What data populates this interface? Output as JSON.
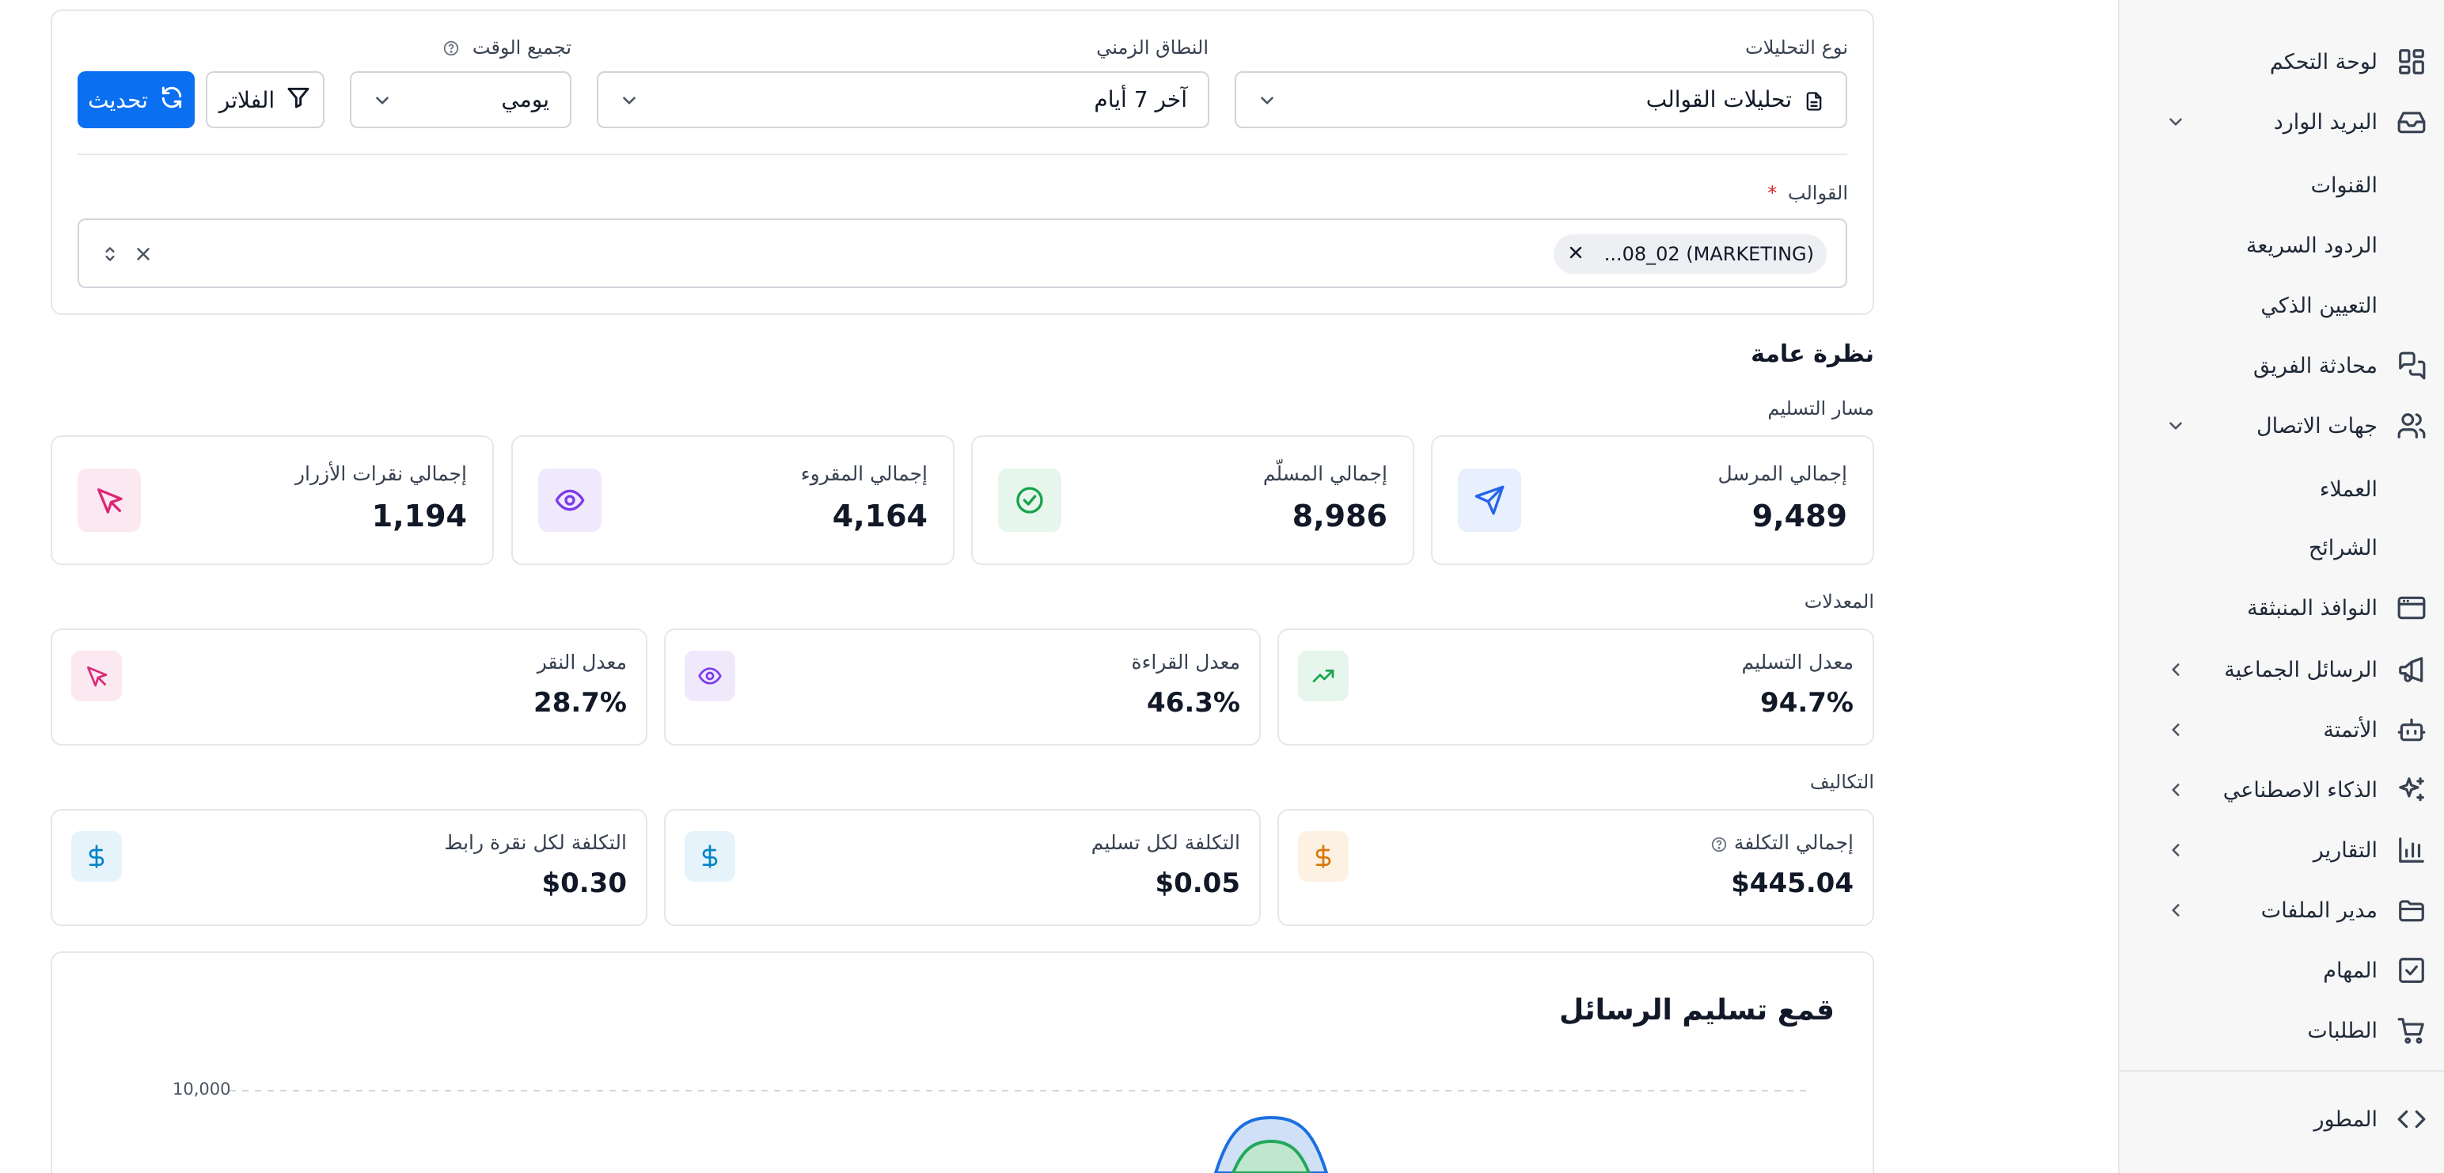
{
  "sidebar": {
    "items": [
      {
        "label": "لوحة التحكم",
        "icon": "dashboard-icon",
        "chevron": "none"
      },
      {
        "label": "البريد الوارد",
        "icon": "inbox-icon",
        "chevron": "down"
      },
      {
        "label": "القنوات",
        "icon": "",
        "chevron": "none"
      },
      {
        "label": "الردود السريعة",
        "icon": "",
        "chevron": "none"
      },
      {
        "label": "التعيين الذكي",
        "icon": "",
        "chevron": "none"
      },
      {
        "label": "محادثة الفريق",
        "icon": "chat-bubbles-icon",
        "chevron": "none"
      },
      {
        "label": "جهات الاتصال",
        "icon": "users-icon",
        "chevron": "down"
      },
      {
        "label": "العملاء",
        "icon": "",
        "chevron": "none"
      },
      {
        "label": "الشرائح",
        "icon": "",
        "chevron": "none"
      },
      {
        "label": "النوافذ المنبثقة",
        "icon": "window-icon",
        "chevron": "none"
      },
      {
        "label": "الرسائل الجماعية",
        "icon": "megaphone-icon",
        "chevron": "left"
      },
      {
        "label": "الأتمتة",
        "icon": "bot-icon",
        "chevron": "left"
      },
      {
        "label": "الذكاء الاصطناعي",
        "icon": "sparkles-icon",
        "chevron": "left"
      },
      {
        "label": "التقارير",
        "icon": "bar-chart-icon",
        "chevron": "left"
      },
      {
        "label": "مدير الملفات",
        "icon": "folder-icon",
        "chevron": "left"
      },
      {
        "label": "المهام",
        "icon": "checkbox-icon",
        "chevron": "none"
      },
      {
        "label": "الطلبات",
        "icon": "cart-icon",
        "chevron": "none"
      },
      {
        "label": "المطور",
        "icon": "code-icon",
        "chevron": "none"
      }
    ]
  },
  "filters": {
    "analytics_type_label": "نوع التحليلات",
    "analytics_type_value": "تحليلات القوالب",
    "time_range_label": "النطاق الزمني",
    "time_range_value": "آخر 7 أيام",
    "time_grouping_label": "تجميع الوقت",
    "time_grouping_value": "يومي",
    "filters_button": "الفلاتر",
    "refresh_button": "تحديث",
    "templates_label": "القوالب",
    "required_mark": "*",
    "template_chip": "...08_02 (MARKETING)"
  },
  "overview": {
    "title": "نظرة عامة",
    "funnel_label": "مسار التسليم",
    "funnel": [
      {
        "title": "إجمالي المرسل",
        "value": "9,489",
        "icon": "send-icon",
        "color": "#2563eb",
        "bg": "#e8f0fe"
      },
      {
        "title": "إجمالي المسلّم",
        "value": "8,986",
        "icon": "check-circle-icon",
        "color": "#16a34a",
        "bg": "#e7f6ec"
      },
      {
        "title": "إجمالي المقروء",
        "value": "4,164",
        "icon": "eye-icon",
        "color": "#7c3aed",
        "bg": "#efe9fb"
      },
      {
        "title": "إجمالي نقرات الأزرار",
        "value": "1,194",
        "icon": "cursor-icon",
        "color": "#db2777",
        "bg": "#fce8f1"
      }
    ],
    "rates_label": "المعدلات",
    "rates": [
      {
        "title": "معدل التسليم",
        "value": "94.7%",
        "icon": "trending-up-icon",
        "color": "#16a34a",
        "bg": "#e7f6ec"
      },
      {
        "title": "معدل القراءة",
        "value": "46.3%",
        "icon": "eye-icon",
        "color": "#7c3aed",
        "bg": "#efe9fb"
      },
      {
        "title": "معدل النقر",
        "value": "28.7%",
        "icon": "cursor-icon",
        "color": "#db2777",
        "bg": "#fce8f1"
      }
    ],
    "costs_label": "التكاليف",
    "costs": [
      {
        "title": "إجمالي التكلفة",
        "value": "$445.04",
        "icon": "dollar-icon",
        "color": "#d97706",
        "bg": "#fdf1e3"
      },
      {
        "title": "التكلفة لكل تسليم",
        "value": "$0.05",
        "icon": "dollar-icon",
        "color": "#0284c7",
        "bg": "#e6f3fb"
      },
      {
        "title": "التكلفة لكل نقرة رابط",
        "value": "$0.30",
        "icon": "dollar-icon",
        "color": "#0284c7",
        "bg": "#e6f3fb"
      }
    ]
  },
  "funnel_chart": {
    "title": "قمع تسليم الرسائل",
    "y_tick": "10,000",
    "outer_color": "#1d6fe0",
    "outer_fill": "#cfe0f7",
    "inner_color": "#22a85a",
    "inner_fill": "#bfe6cf"
  }
}
